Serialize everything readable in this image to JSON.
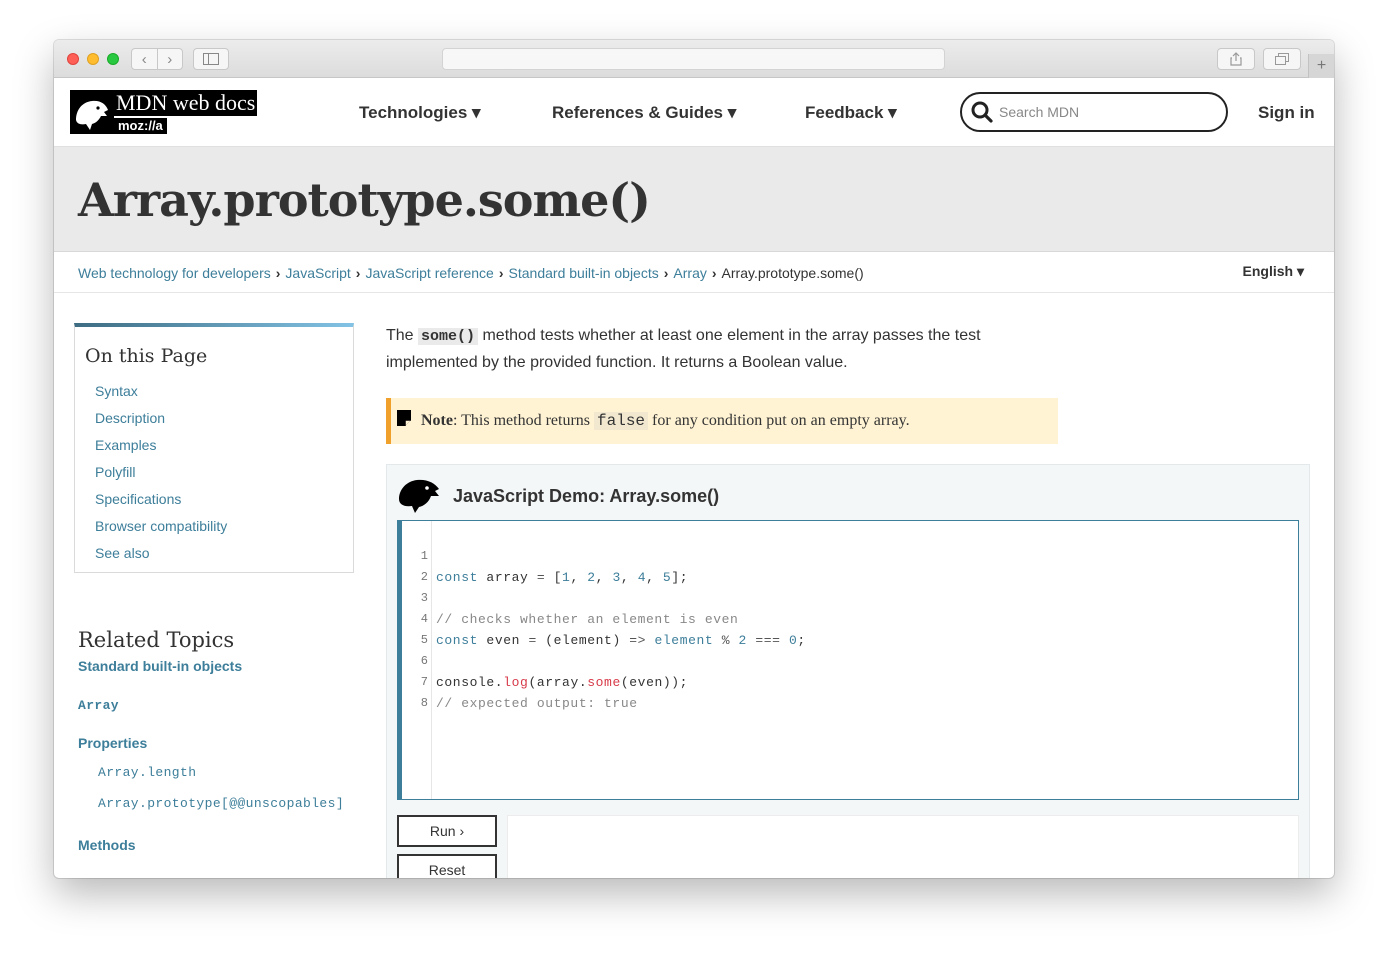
{
  "header": {
    "logo_text": "MDN web docs",
    "logo_sub": "moz://a",
    "nav": [
      "Technologies ▾",
      "References & Guides ▾",
      "Feedback ▾"
    ],
    "search_placeholder": "Search MDN",
    "sign_in": "Sign in"
  },
  "page_title": "Array.prototype.some()",
  "breadcrumbs": {
    "items": [
      "Web technology for developers",
      "JavaScript",
      "JavaScript reference",
      "Standard built-in objects",
      "Array"
    ],
    "current": "Array.prototype.some()",
    "separator": "›"
  },
  "language": "English ▾",
  "toc": {
    "heading": "On this Page",
    "items": [
      "Syntax",
      "Description",
      "Examples",
      "Polyfill",
      "Specifications",
      "Browser compatibility",
      "See also"
    ]
  },
  "related": {
    "heading": "Related Topics",
    "section": "Standard built-in objects",
    "array": "Array",
    "properties_label": "Properties",
    "properties": [
      "Array.length",
      "Array.prototype[@@unscopables]"
    ],
    "methods_label": "Methods"
  },
  "intro": {
    "before": "The ",
    "code": "some()",
    "after": " method tests whether at least one element in the array passes the test implemented by the provided function. It returns a Boolean value."
  },
  "note": {
    "label": "Note",
    "before": ": This method returns ",
    "code": "false",
    "after": " for any condition put on an empty array."
  },
  "demo": {
    "title": "JavaScript Demo: Array.some()",
    "line_numbers": [
      "1",
      "2",
      "3",
      "4",
      "5",
      "6",
      "7",
      "8"
    ],
    "run_label": "Run ›",
    "reset_label": "Reset"
  },
  "colors": {
    "link": "#3d7e9a",
    "note_bg": "#fff3d4",
    "note_border": "#f0a12b",
    "title_band": "#eaeaea"
  }
}
